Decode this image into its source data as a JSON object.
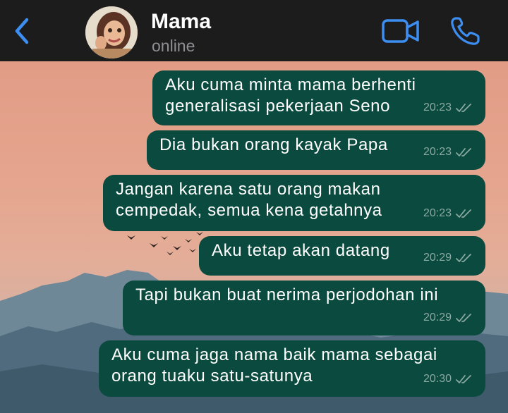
{
  "header": {
    "back_icon": "chevron-left-icon",
    "contact_name": "Mama",
    "status": "online",
    "video_icon": "video-camera-icon",
    "call_icon": "phone-icon",
    "accent_color": "#3d8ef0"
  },
  "chat": {
    "bubble_color": "#0b4a3e",
    "messages": [
      {
        "text": "Aku cuma minta mama berhenti\ngeneralisasi pekerjaan Seno",
        "time": "20:23",
        "status": "read"
      },
      {
        "text": "Dia bukan orang kayak Papa",
        "time": "20:23",
        "status": "read"
      },
      {
        "text": "Jangan karena satu orang makan\ncempedak, semua kena getahnya",
        "time": "20:23",
        "status": "read"
      },
      {
        "text": "Aku tetap akan datang",
        "time": "20:29",
        "status": "read"
      },
      {
        "text": "Tapi bukan buat nerima perjodohan ini",
        "time": "20:29",
        "status": "read"
      },
      {
        "text": "Aku cuma jaga nama baik mama sebagai\norang tuaku satu-satunya",
        "time": "20:30",
        "status": "read"
      }
    ]
  }
}
